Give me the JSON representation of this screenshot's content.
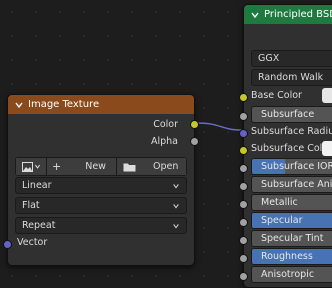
{
  "image_texture": {
    "title": "Image Texture",
    "header_color": "#8b4a1c",
    "outputs": {
      "color": "Color",
      "alpha": "Alpha"
    },
    "buttons": {
      "new": "New",
      "open": "Open"
    },
    "interpolation": "Linear",
    "projection": "Flat",
    "extension": "Repeat",
    "input_vector": "Vector"
  },
  "principled": {
    "title": "Principled BSDF",
    "header_color": "#1f7a40",
    "distribution": "GGX",
    "subsurface_method": "Random Walk",
    "rows": {
      "base_color": "Base Color",
      "subsurface": "Subsurface",
      "subsurface_radius": "Subsurface Radius",
      "subsurface_color": "Subsurface Col...",
      "subsurface_ior": "Subsurface IOR",
      "subsurface_anisotropy": "Subsurface Anisotro",
      "metallic": "Metallic",
      "specular": "Specular",
      "specular_tint": "Specular Tint",
      "roughness": "Roughness",
      "anisotropic": "Anisotropic"
    },
    "fills": {
      "subsurface_ior": 0.35,
      "specular": 1.0,
      "roughness": 0.85
    }
  },
  "colors": {
    "accent_blue": "#4772b3",
    "socket_yellow": "#c7c729",
    "socket_gray": "#a1a1a1",
    "socket_purple": "#6363c7"
  }
}
